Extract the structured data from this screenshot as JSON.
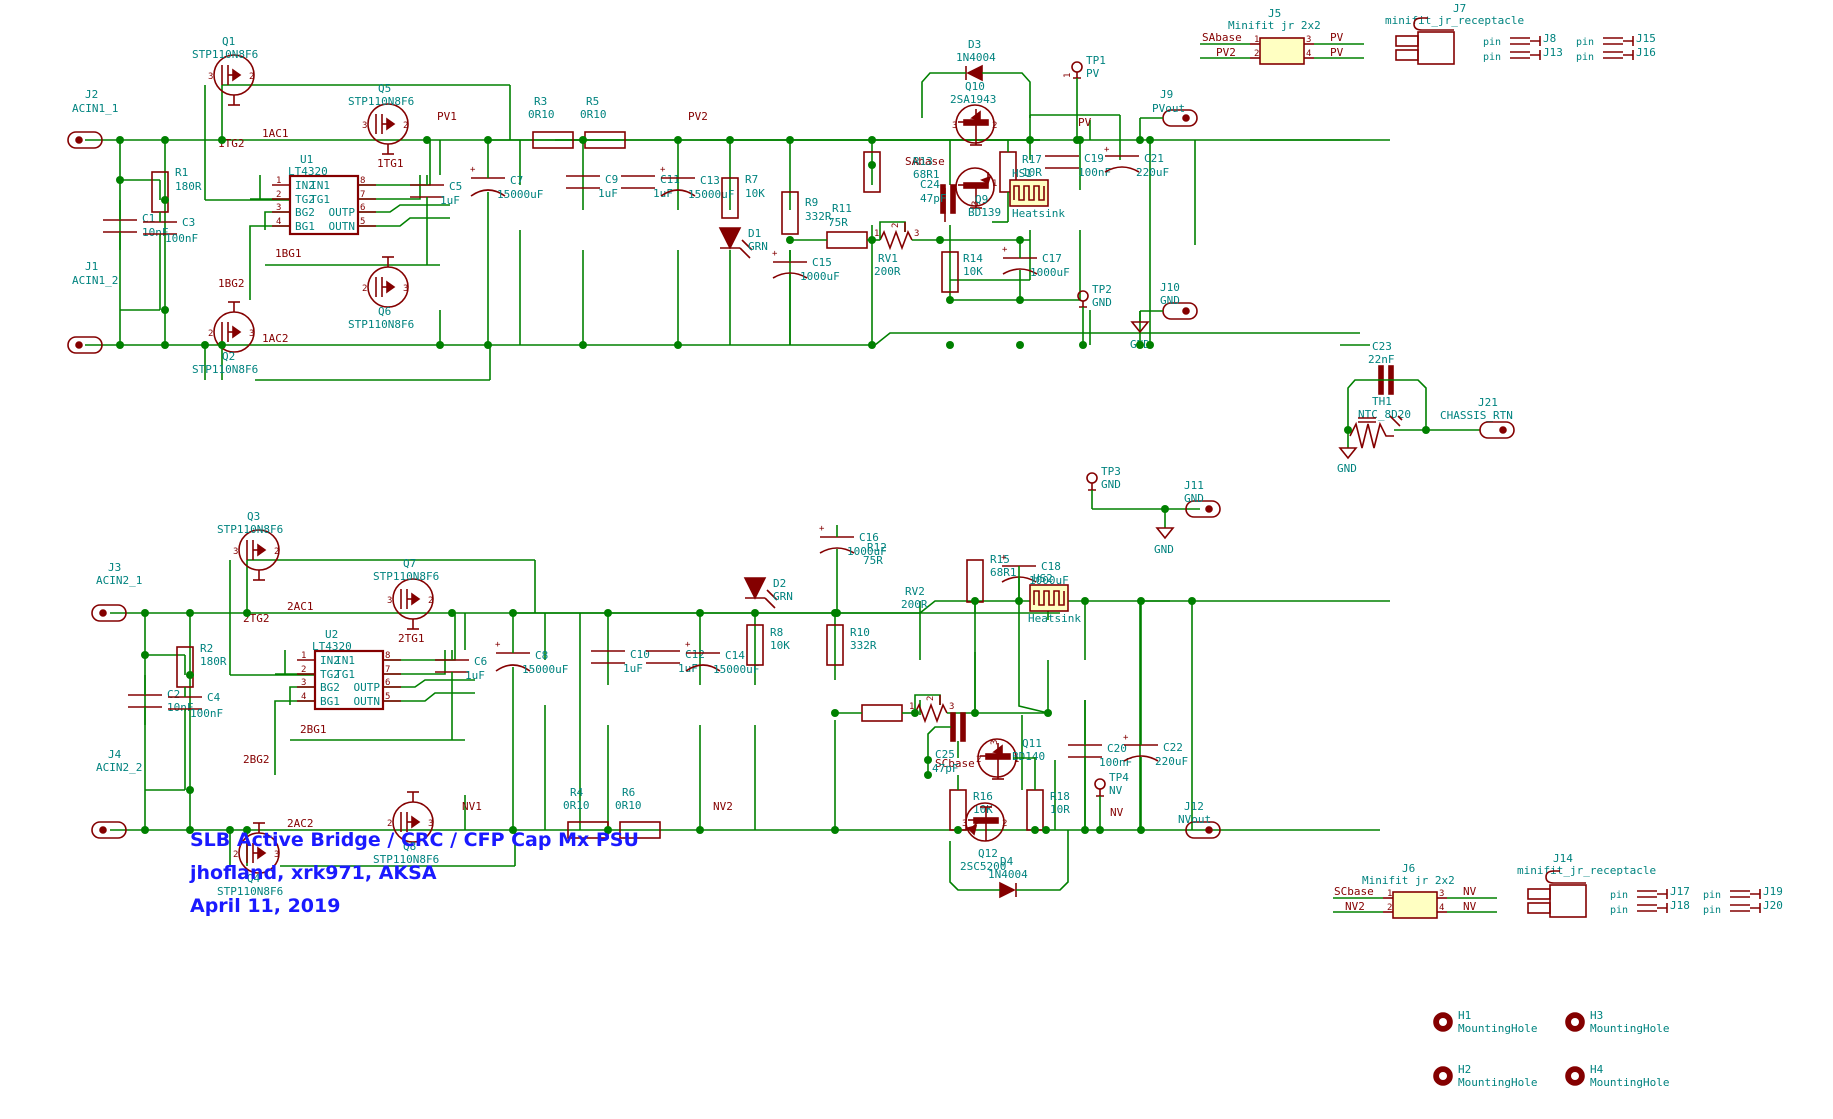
{
  "sheet": {
    "title_lines": [
      "SLB Active Bridge / CRC / CFP Cap Mx PSU",
      "jhofland, xrk971, AKSA",
      "April 11, 2019"
    ],
    "title_color": "#1a1aff",
    "wire_color": "#008000",
    "symbol_color": "#840000",
    "label_color": "#00837f"
  },
  "positive_section": {
    "connectors": [
      {
        "ref": "J2",
        "value": "ACIN1_1"
      },
      {
        "ref": "J1",
        "value": "ACIN1_2"
      },
      {
        "ref": "J9",
        "value": "PVout"
      },
      {
        "ref": "J10",
        "value": "GND"
      }
    ],
    "mosfets": [
      {
        "ref": "Q1",
        "value": "STP110N8F6"
      },
      {
        "ref": "Q2",
        "value": "STP110N8F6"
      },
      {
        "ref": "Q5",
        "value": "STP110N8F6"
      },
      {
        "ref": "Q6",
        "value": "STP110N8F6"
      }
    ],
    "ic": {
      "ref": "U1",
      "value": "LT4320",
      "pins_left": [
        {
          "n": "1",
          "name": "IN2"
        },
        {
          "n": "2",
          "name": "TG2"
        },
        {
          "n": "3",
          "name": "BG2"
        },
        {
          "n": "4",
          "name": "BG1"
        }
      ],
      "pins_right": [
        {
          "n": "8",
          "name": "IN1"
        },
        {
          "n": "7",
          "name": "TG1"
        },
        {
          "n": "6",
          "name": "OUTP"
        },
        {
          "n": "5",
          "name": "OUTN"
        }
      ]
    },
    "resistors": [
      {
        "ref": "R1",
        "value": "180R"
      },
      {
        "ref": "R3",
        "value": "0R10"
      },
      {
        "ref": "R5",
        "value": "0R10"
      },
      {
        "ref": "R7",
        "value": "10K"
      },
      {
        "ref": "R9",
        "value": "332R"
      },
      {
        "ref": "R11",
        "value": "75R"
      },
      {
        "ref": "R13",
        "value": "68R1"
      },
      {
        "ref": "R14",
        "value": "10K"
      },
      {
        "ref": "R17",
        "value": "10R"
      },
      {
        "ref": "RV1",
        "value": "200R"
      }
    ],
    "capacitors": [
      {
        "ref": "C1",
        "value": "10nF"
      },
      {
        "ref": "C3",
        "value": "100nF"
      },
      {
        "ref": "C5",
        "value": "1uF"
      },
      {
        "ref": "C7",
        "value": "15000uF"
      },
      {
        "ref": "C9",
        "value": "1uF"
      },
      {
        "ref": "C11",
        "value": "1uF"
      },
      {
        "ref": "C13",
        "value": "15000uF"
      },
      {
        "ref": "C15",
        "value": "1000uF"
      },
      {
        "ref": "C17",
        "value": "1000uF"
      },
      {
        "ref": "C19",
        "value": "100nF"
      },
      {
        "ref": "C21",
        "value": "220uF"
      },
      {
        "ref": "C24",
        "value": "47pF"
      }
    ],
    "diodes": [
      {
        "ref": "D1",
        "value": "GRN"
      },
      {
        "ref": "D3",
        "value": "1N4004"
      }
    ],
    "transistors": [
      {
        "ref": "Q10",
        "value": "2SA1943"
      },
      {
        "ref": "Q9",
        "value": "BD139"
      }
    ],
    "heatsink": {
      "ref": "HS1",
      "value": "Heatsink"
    },
    "testpoints": [
      {
        "ref": "TP1",
        "value": "PV"
      },
      {
        "ref": "TP2",
        "value": "GND"
      }
    ],
    "nets": [
      "1AC1",
      "1AC2",
      "1TG1",
      "1TG2",
      "1BG1",
      "1BG2",
      "PV1",
      "PV2",
      "PV",
      "SAbase",
      "GND"
    ]
  },
  "negative_section": {
    "connectors": [
      {
        "ref": "J3",
        "value": "ACIN2_1"
      },
      {
        "ref": "J4",
        "value": "ACIN2_2"
      },
      {
        "ref": "J11",
        "value": "GND"
      },
      {
        "ref": "J12",
        "value": "NVout"
      }
    ],
    "mosfets": [
      {
        "ref": "Q3",
        "value": "STP110N8F6"
      },
      {
        "ref": "Q4",
        "value": "STP110N8F6"
      },
      {
        "ref": "Q7",
        "value": "STP110N8F6"
      },
      {
        "ref": "Q8",
        "value": "STP110N8F6"
      }
    ],
    "ic": {
      "ref": "U2",
      "value": "LT4320",
      "pins_left": [
        {
          "n": "1",
          "name": "IN2"
        },
        {
          "n": "2",
          "name": "TG2"
        },
        {
          "n": "3",
          "name": "BG2"
        },
        {
          "n": "4",
          "name": "BG1"
        }
      ],
      "pins_right": [
        {
          "n": "8",
          "name": "IN1"
        },
        {
          "n": "7",
          "name": "TG1"
        },
        {
          "n": "6",
          "name": "OUTP"
        },
        {
          "n": "5",
          "name": "OUTN"
        }
      ]
    },
    "resistors": [
      {
        "ref": "R2",
        "value": "180R"
      },
      {
        "ref": "R4",
        "value": "0R10"
      },
      {
        "ref": "R6",
        "value": "0R10"
      },
      {
        "ref": "R8",
        "value": "10K"
      },
      {
        "ref": "R10",
        "value": "332R"
      },
      {
        "ref": "R12",
        "value": "75R"
      },
      {
        "ref": "R15",
        "value": "68R1"
      },
      {
        "ref": "R16",
        "value": "10K"
      },
      {
        "ref": "R18",
        "value": "10R"
      },
      {
        "ref": "RV2",
        "value": "200R"
      }
    ],
    "capacitors": [
      {
        "ref": "C2",
        "value": "10nF"
      },
      {
        "ref": "C4",
        "value": "100nF"
      },
      {
        "ref": "C6",
        "value": "1uF"
      },
      {
        "ref": "C8",
        "value": "15000uF"
      },
      {
        "ref": "C10",
        "value": "1uF"
      },
      {
        "ref": "C12",
        "value": "1uF"
      },
      {
        "ref": "C14",
        "value": "15000uF"
      },
      {
        "ref": "C16",
        "value": "1000uF"
      },
      {
        "ref": "C18",
        "value": "1000uF"
      },
      {
        "ref": "C20",
        "value": "100nF"
      },
      {
        "ref": "C22",
        "value": "220uF"
      },
      {
        "ref": "C25",
        "value": "47pF"
      }
    ],
    "diodes": [
      {
        "ref": "D2",
        "value": "GRN"
      },
      {
        "ref": "D4",
        "value": "1N4004"
      }
    ],
    "transistors": [
      {
        "ref": "Q11",
        "value": "BD140"
      },
      {
        "ref": "Q12",
        "value": "2SC5200"
      }
    ],
    "heatsink": {
      "ref": "HS2",
      "value": "Heatsink"
    },
    "testpoints": [
      {
        "ref": "TP3",
        "value": "GND"
      },
      {
        "ref": "TP4",
        "value": "NV"
      }
    ],
    "nets": [
      "2AC1",
      "2AC2",
      "2TG1",
      "2TG2",
      "2BG1",
      "2BG2",
      "NV1",
      "NV2",
      "NV",
      "SCbase",
      "GND"
    ]
  },
  "power_connectors": [
    {
      "ref": "J5",
      "value": "Minifit jr 2x2",
      "pins": [
        {
          "n": "1",
          "label": "SAbase"
        },
        {
          "n": "2",
          "label": "PV2"
        },
        {
          "n": "3",
          "label": "PV"
        },
        {
          "n": "4",
          "label": "PV"
        }
      ]
    },
    {
      "ref": "J6",
      "value": "Minifit jr 2x2",
      "pins": [
        {
          "n": "1",
          "label": "SCbase"
        },
        {
          "n": "2",
          "label": "NV2"
        },
        {
          "n": "3",
          "label": "NV"
        },
        {
          "n": "4",
          "label": "NV"
        }
      ]
    }
  ],
  "receptacles": [
    {
      "ref": "J7",
      "value": "minifit_jr_receptacle",
      "pins": [
        {
          "name": "pin",
          "ref": "J8"
        },
        {
          "name": "pin",
          "ref": "J13"
        }
      ],
      "extra": [
        {
          "ref": "J15"
        },
        {
          "ref": "J16"
        }
      ]
    },
    {
      "ref": "J14",
      "value": "minifit_jr_receptacle",
      "pins": [
        {
          "name": "pin",
          "ref": "J17"
        },
        {
          "name": "pin",
          "ref": "J18"
        }
      ],
      "extra": [
        {
          "ref": "J19"
        },
        {
          "ref": "J20"
        }
      ]
    }
  ],
  "chassis": {
    "cap": {
      "ref": "C23",
      "value": "22nF"
    },
    "thermistor": {
      "ref": "TH1",
      "value": "NTC_8D20"
    },
    "connector": {
      "ref": "J21",
      "value": "CHASSIS_RTN"
    },
    "gnd_label": "GND"
  },
  "mounting_holes": [
    {
      "ref": "H1",
      "value": "MountingHole"
    },
    {
      "ref": "H2",
      "value": "MountingHole"
    },
    {
      "ref": "H3",
      "value": "MountingHole"
    },
    {
      "ref": "H4",
      "value": "MountingHole"
    }
  ],
  "pin_word": "pin"
}
